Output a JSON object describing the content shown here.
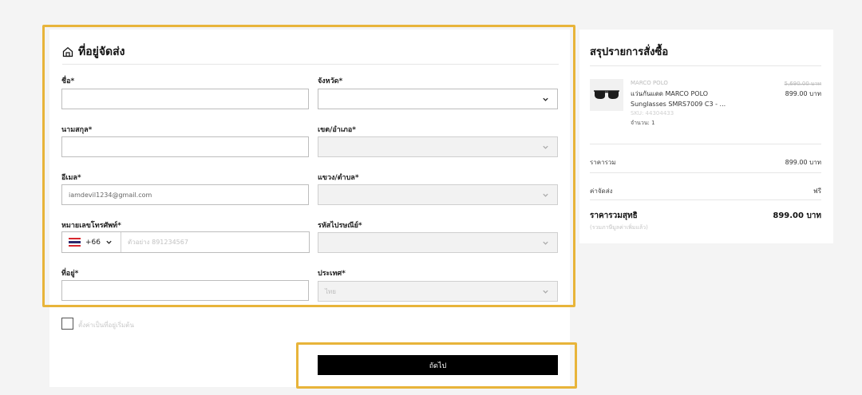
{
  "form": {
    "title": "ที่อยู่จัดส่ง",
    "first_name": {
      "label": "ชื่อ*",
      "value": ""
    },
    "last_name": {
      "label": "นามสกุล*",
      "value": ""
    },
    "email": {
      "label": "อีเมล*",
      "value": "iamdevil1234@gmail.com"
    },
    "phone": {
      "label": "หมายเลขโทรศัพท์*",
      "country_code": "+66",
      "placeholder": "ตัวอย่าง 891234567"
    },
    "address": {
      "label": "ที่อยู่*",
      "value": ""
    },
    "province": {
      "label": "จังหวัด*",
      "value": ""
    },
    "district": {
      "label": "เขต/อำเภอ*",
      "value": ""
    },
    "subdistrict": {
      "label": "แขวง/ตำบล*",
      "value": ""
    },
    "postcode": {
      "label": "รหัสไปรษณีย์*",
      "value": ""
    },
    "country": {
      "label": "ประเทศ*",
      "value": "ไทย"
    },
    "set_default_label": "ตั้งค่าเป็นที่อยู่เริ่มต้น",
    "next_label": "ถัดไป"
  },
  "summary": {
    "title": "สรุปรายการสั่งซื้อ",
    "item": {
      "brand": "MARCO POLO",
      "name": "แว่นกันแดด MARCO POLO Sunglasses SMRS7009 C3 - ...",
      "sku": "SKU: 44304433",
      "qty": "จำนวน: 1",
      "old_price": "5,690.00 บาท",
      "price": "899.00 บาท"
    },
    "subtotal_label": "ราคารวม",
    "subtotal_value": "899.00 บาท",
    "shipping_label": "ค่าจัดส่ง",
    "shipping_value": "ฟรี",
    "net_label": "ราคารวมสุทธิ",
    "net_sub": "(รวมภาษีมูลค่าเพิ่มแล้ว)",
    "net_value": "899.00 บาท"
  },
  "colors": {
    "highlight": "#e8b43a",
    "button": "#000000",
    "background": "#f4f4f4"
  }
}
